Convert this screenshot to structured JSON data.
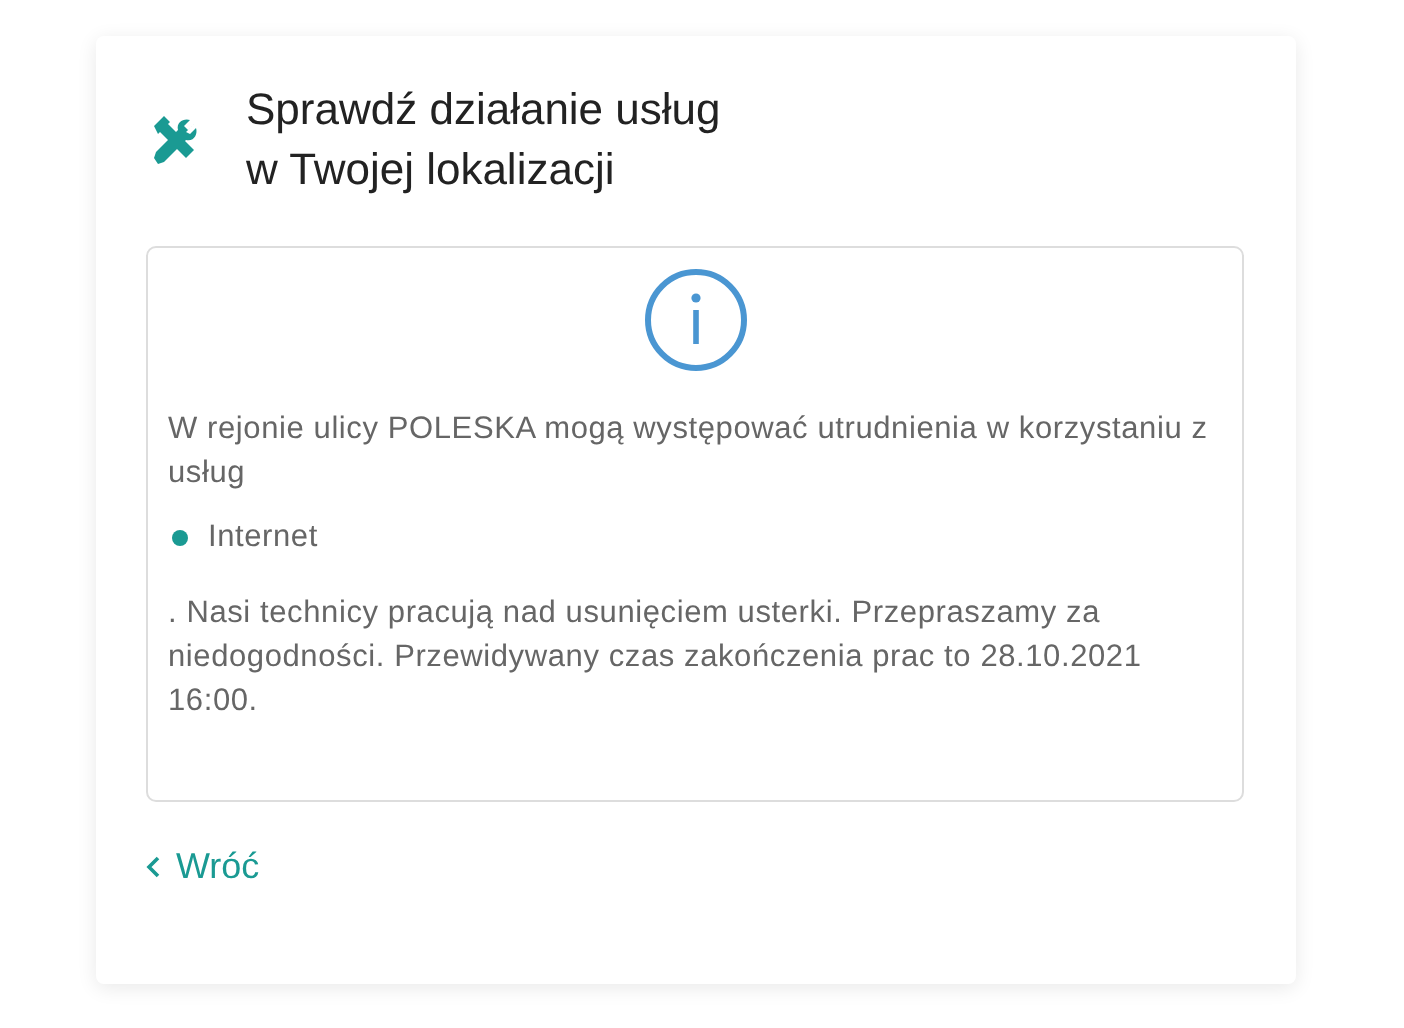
{
  "header": {
    "title_lines": [
      "Sprawdź działanie usług",
      "w Twojej lokalizacji"
    ]
  },
  "notice": {
    "message": "W rejonie ulicy POLESKA mogą występować utrudnienia w korzystaniu z usług",
    "services": [
      {
        "label": "Internet",
        "color": "#1a9a93"
      }
    ],
    "details": ". Nasi technicy pracują nad usunięciem usterki. Przepraszamy za niedogodności. Przewidywany czas zakończenia prac to 28.10.2021 16:00."
  },
  "back_link": {
    "label": "Wróć"
  }
}
